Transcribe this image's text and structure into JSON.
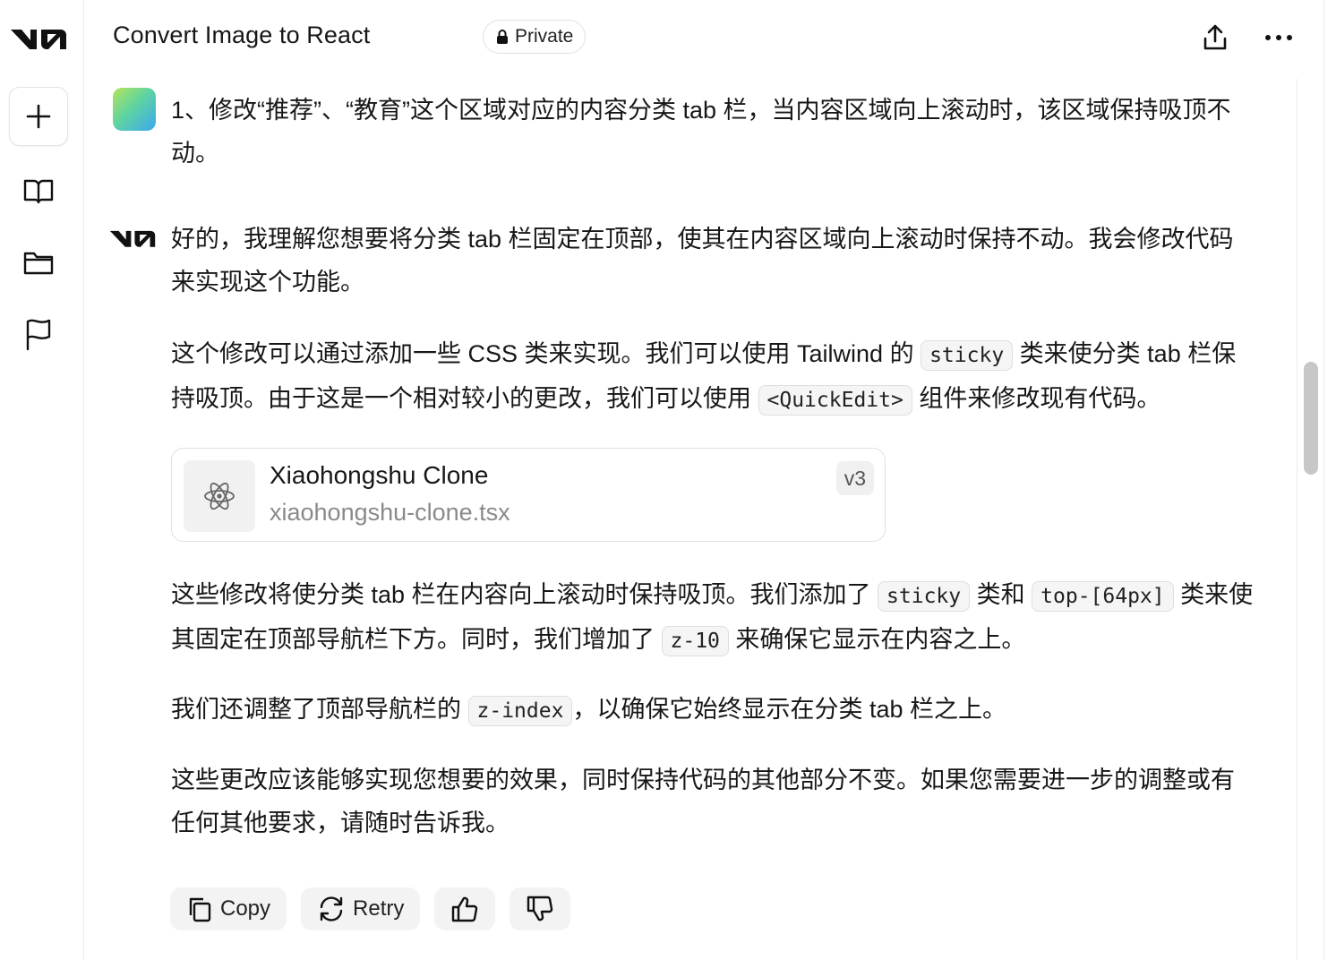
{
  "header": {
    "title": "Convert Image to React",
    "visibility": "Private",
    "icons": [
      "share-icon",
      "more-icon"
    ]
  },
  "rail": {
    "icons": [
      "v0-logo",
      "plus-icon",
      "book-icon",
      "folder-icon",
      "flag-icon"
    ]
  },
  "user_message": {
    "text": "1、修改“推荐”、“教育”这个区域对应的内容分类 tab 栏，当内容区域向上滚动时，该区域保持吸顶不动。"
  },
  "assistant": {
    "intro": "好的，我理解您想要将分类 tab 栏固定在顶部，使其在内容区域向上滚动时保持不动。我会修改代码来实现这个功能。",
    "p2": {
      "a": "这个修改可以通过添加一些 CSS 类来实现。我们可以使用 Tailwind 的 ",
      "code1": "sticky",
      "b": " 类来使分类 tab 栏保持吸顶。由于这是一个相对较小的更改，我们可以使用 ",
      "code2": "<QuickEdit>",
      "c": " 组件来修改现有代码。"
    },
    "file_card": {
      "name": "Xiaohongshu Clone",
      "path": "xiaohongshu-clone.tsx",
      "version": "v3",
      "icon": "react-icon"
    },
    "p3": {
      "a": "这些修改将使分类 tab 栏在内容向上滚动时保持吸顶。我们添加了 ",
      "code1": "sticky",
      "b": " 类和 ",
      "code2": "top-[64px]",
      "c": " 类来使其固定在顶部导航栏下方。同时，我们增加了 ",
      "code3": "z-10",
      "d": " 来确保它显示在内容之上。"
    },
    "p4": {
      "a": "我们还调整了顶部导航栏的 ",
      "code1": "z-index",
      "b": "，以确保它始终显示在分类 tab 栏之上。"
    },
    "p5": "这些更改应该能够实现您想要的效果，同时保持代码的其他部分不变。如果您需要进一步的调整或有任何其他要求，请随时告诉我。"
  },
  "actions": {
    "copy": "Copy",
    "retry": "Retry"
  }
}
